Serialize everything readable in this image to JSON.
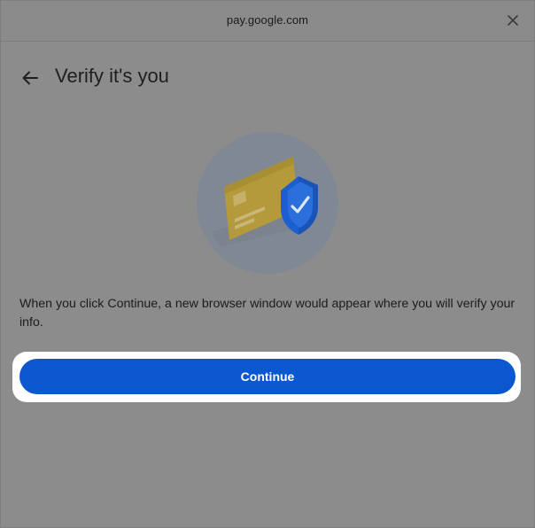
{
  "window": {
    "url": "pay.google.com",
    "close_icon": "close-icon"
  },
  "header": {
    "back_icon": "arrow-left-icon",
    "title": "Verify it's you"
  },
  "illustration": {
    "description_icon": "card-with-shield-checkmark-icon",
    "colors": {
      "circle": "#7f8793",
      "card": "#b49a3a",
      "shield": "#1c5fd0",
      "check": "#dce6f4"
    }
  },
  "body": {
    "message": "When you click Continue, a new browser window would appear where you will verify your info."
  },
  "actions": {
    "continue_label": "Continue"
  },
  "colors": {
    "accent": "#0b57d0",
    "highlight_ring": "#ffffff"
  }
}
